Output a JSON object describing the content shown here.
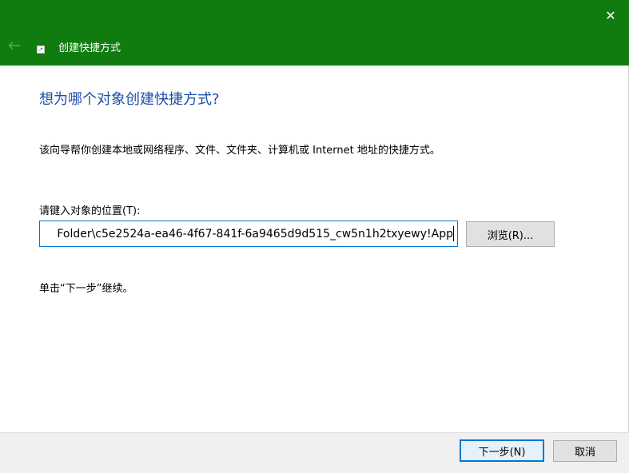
{
  "window": {
    "title": "创建快捷方式",
    "close_icon": "✕",
    "back_icon": "arrow-left-icon"
  },
  "main": {
    "heading": "想为哪个对象创建快捷方式?",
    "description": "该向导帮你创建本地或网络程序、文件、文件夹、计算机或 Internet 地址的快捷方式。",
    "location_label": "请键入对象的位置(T):",
    "location_value": "Folder\\c5e2524a-ea46-4f67-841f-6a9465d9d515_cw5n1h2txyewy!App",
    "browse_label": "浏览(R)...",
    "continue_hint": "单击“下一步”继续。"
  },
  "footer": {
    "next_label": "下一步(N)",
    "cancel_label": "取消"
  },
  "colors": {
    "titlebar": "#107c10",
    "heading": "#1e4fa8",
    "focus_border": "#0078d7"
  }
}
